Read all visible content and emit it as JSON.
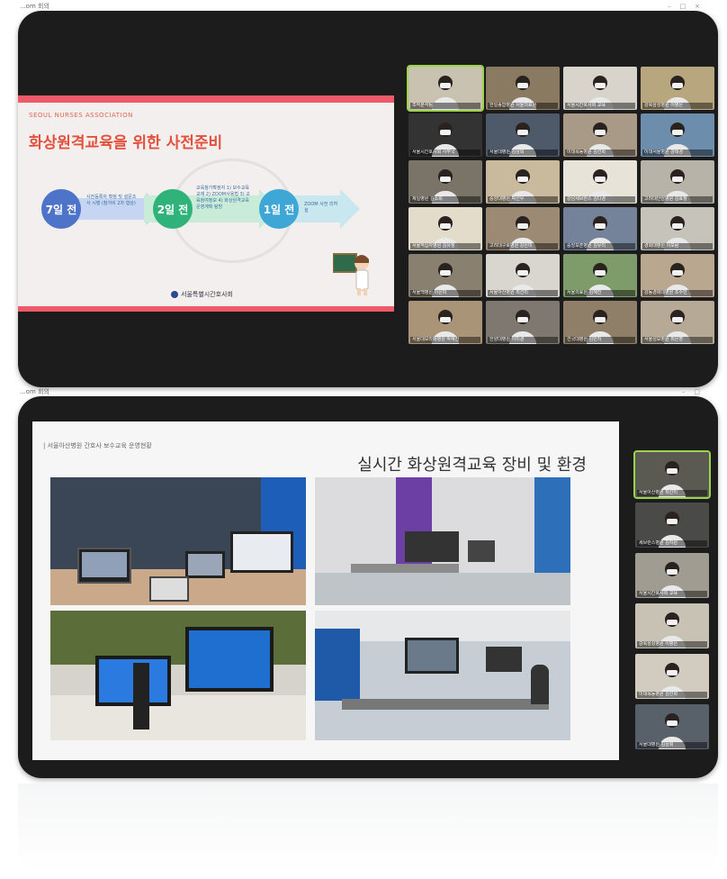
{
  "window1": {
    "title_bar_text": "...om 회의",
    "slide": {
      "association": "SEOUL NURSES ASSOCIATION",
      "title": "화상원격교육을 위한 사전준비",
      "steps": [
        {
          "label": "7일 전",
          "detail": "사전등록자 확정 및 설문조사 시행 (참가비 2차 협상)",
          "color": "#4e74c9"
        },
        {
          "label": "2일 전",
          "detail": "교육참가확정자 1) 보수교육 교재 2) ZOOM사용법 3) 교육참여정보 4) 화상원격교육 운영계획 탐방",
          "color": "#2fb37a"
        },
        {
          "label": "1일 전",
          "detail": "ZOOM 사전 리허설",
          "color": "#3fa7d6"
        }
      ],
      "org_name": "서울특별시간호사회"
    },
    "gallery": [
      {
        "name": "조작분석팀",
        "bg": "#c9c2b0",
        "active": true
      },
      {
        "name": "한일종합병원 서울의료원",
        "bg": "#8a7a62"
      },
      {
        "name": "서울시간호사회 교육",
        "bg": "#d8d4cc"
      },
      {
        "name": "강북삼성병원 이병은",
        "bg": "#b8a67f"
      },
      {
        "name": "서울시간호사회 사무국",
        "bg": "#333333"
      },
      {
        "name": "서울대병원 김상희",
        "bg": "#4e5a6a"
      },
      {
        "name": "이대목동병원 김선희",
        "bg": "#a89a86"
      },
      {
        "name": "이대서울병원 강태경",
        "bg": "#6d8dad"
      },
      {
        "name": "제일병원 김소희",
        "bg": "#7a7468"
      },
      {
        "name": "중앙대병원 박선우",
        "bg": "#c9b99d"
      },
      {
        "name": "강남세브란스 김다경",
        "bg": "#e7e3d9"
      },
      {
        "name": "고려대안암병원 김효정",
        "bg": "#b7b3a8"
      },
      {
        "name": "서울적십자병원 김유정",
        "bg": "#e3dccb"
      },
      {
        "name": "고려대구로병원 강은미",
        "bg": "#9c8a74"
      },
      {
        "name": "중앙보훈병원 김유리",
        "bg": "#75839a"
      },
      {
        "name": "경희대병원 이보람",
        "bg": "#c6c3bb"
      },
      {
        "name": "서울백병원 이은미",
        "bg": "#8a8070"
      },
      {
        "name": "서울아산병원 최선미",
        "bg": "#d9d6d0"
      },
      {
        "name": "서울의료원 김혜진",
        "bg": "#7d9c6a"
      },
      {
        "name": "강동경희대병원 조수빈",
        "bg": "#b9a790"
      },
      {
        "name": "서울대보라매병원 박혜진",
        "bg": "#a99478"
      },
      {
        "name": "한양대병원 이미경",
        "bg": "#7e7870"
      },
      {
        "name": "건국대병원 김민지",
        "bg": "#8f7e68"
      },
      {
        "name": "서울성모병원 최은영",
        "bg": "#b6aa96"
      }
    ]
  },
  "window2": {
    "title_bar_text": "...om 회의",
    "slide": {
      "subtitle": "| 서울아산병원 간호사 보수교육 운영현황",
      "title": "실시간 화상원격교육 장비 및 환경"
    },
    "gallery": [
      {
        "name": "서울아산병원 최선미",
        "bg": "#5a5a52",
        "active": true
      },
      {
        "name": "세브란스병원 김지원",
        "bg": "#4a4a48"
      },
      {
        "name": "서울시간호사회 교육",
        "bg": "#a19c92"
      },
      {
        "name": "강북삼성병원 이병은",
        "bg": "#c7c2b4"
      },
      {
        "name": "이대목동병원 김선희",
        "bg": "#d2ccc0"
      },
      {
        "name": "서울대병원 김상희",
        "bg": "#58606a"
      }
    ]
  }
}
